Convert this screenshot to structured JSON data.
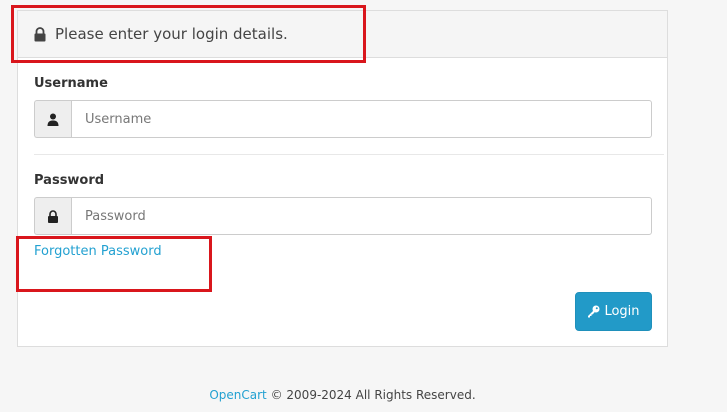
{
  "panel": {
    "heading": "Please enter your login details.",
    "heading_icon": "lock-icon"
  },
  "form": {
    "username_label": "Username",
    "username_placeholder": "Username",
    "username_icon": "user-icon",
    "password_label": "Password",
    "password_placeholder": "Password",
    "password_icon": "lock-icon",
    "forgot_link": "Forgotten Password",
    "login_button": "Login",
    "login_icon": "key-icon"
  },
  "footer": {
    "brand_link": "OpenCart",
    "copyright": "© 2009-2024 All Rights Reserved."
  },
  "colors": {
    "accent": "#229ac8",
    "link": "#23a1d1",
    "highlight_box": "#d9161c"
  }
}
